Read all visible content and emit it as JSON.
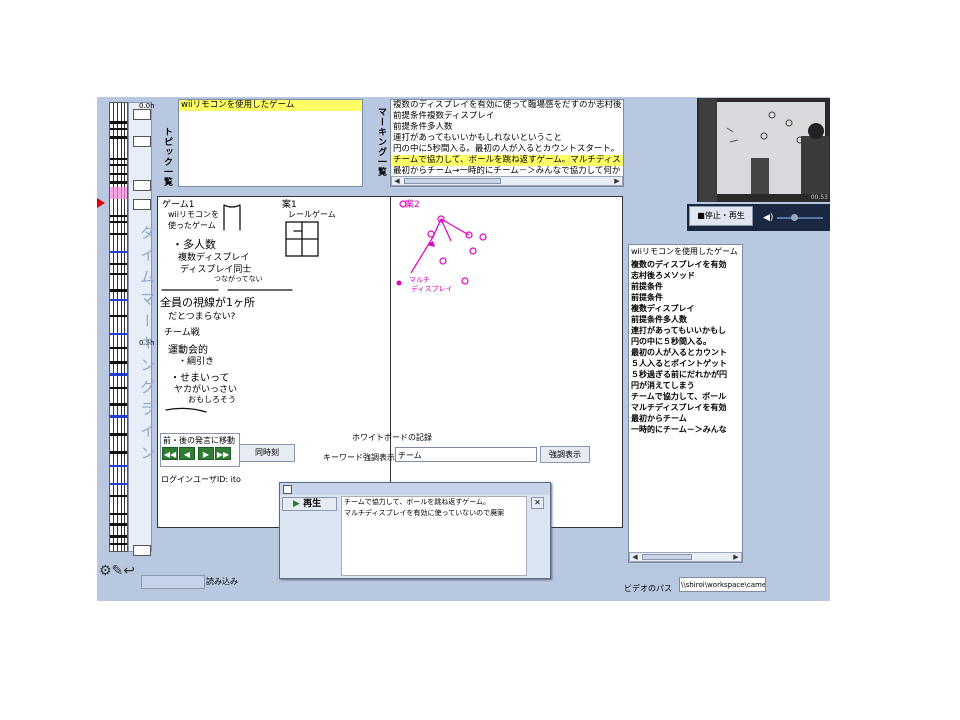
{
  "timeline": {
    "label_top": "0.0h",
    "label_mid": "0.5h",
    "vertical_title": "タイムマーキングライン"
  },
  "topics": {
    "panel_title": "トピック一覧",
    "items": [
      "wiiリモコンを使用したゲーム"
    ]
  },
  "markings": {
    "panel_title": "マーキング一覧",
    "items": [
      "複数のディスプレイを有効に使って臨場感をだすのか志村後",
      "前提条件複数ディスプレイ",
      "前提条件多人数",
      "連打があってもいいかもしれないということ",
      "円の中に5秒間入る。最初の人が入るとカウントスタート。",
      "チームで協力して、ボールを跳ね返すゲーム。マルチディス",
      "最初からチーム→一時的にチーム－＞みんなで協力して何か"
    ],
    "highlight_index": 5
  },
  "video": {
    "stop_play_label": "■停止・再生",
    "time": "00:53"
  },
  "notes_list": {
    "title": "wiiリモコンを使用したゲーム",
    "items": [
      "複数のディスプレイを有効",
      "志村後ろメソッド",
      "前提条件",
      "前提条件",
      "複数ディスプレイ",
      "前提条件多人数",
      "連打があってもいいかもし",
      "円の中に５秒間入る。",
      "最初の人が入るとカウント",
      "５人入るとポイントゲット",
      "５秒過ぎる前にだれかが円",
      "円が消えてしまう",
      "チームで協力して、ボール",
      "マルチディスプレイを有効",
      "最初からチーム",
      "一時的にチーム－＞みんな"
    ]
  },
  "whiteboard": {
    "left_texts": [
      "ゲーム1",
      "wiiリモコンを",
      "使ったゲーム",
      "・多人数",
      "複数ディスプレイ",
      "ディスプレイ同士",
      "つながってない",
      "全員の視線が1ヶ所",
      "だとつまらない?",
      "チーム戦",
      "運動会的",
      "・綱引き",
      "・せまいって",
      "ヤカがいっさい",
      "おもしろそう",
      "案1",
      "レールゲーム"
    ],
    "right_texts": [
      "案2",
      "マルチ",
      "ディスプレイ"
    ],
    "record_label": "ホワイトボードの記録"
  },
  "controls": {
    "nav_label": "前・後の発言に移動",
    "same_time_button": "同時刻",
    "keyword_label": "キーワード強調表示",
    "keyword_value": "チーム",
    "highlight_button": "強調表示",
    "login_label": "ログインユーザID: ito",
    "load_label": "読み込み",
    "video_path_label": "ビデオのパス",
    "video_path_value": "\\\\shiroi\\workspace\\camera"
  },
  "popup": {
    "play_label": "再生",
    "close_label": "✕",
    "lines": [
      "チームで協力して、ボールを跳ね返すゲーム。",
      "マルチディスプレイを有効に使っていないので廃案"
    ]
  },
  "colors": {
    "app_bg": "#b8c8e0",
    "highlight": "#ffff66",
    "marker_pink": "#e000c0",
    "play_green": "#2e7d32"
  }
}
